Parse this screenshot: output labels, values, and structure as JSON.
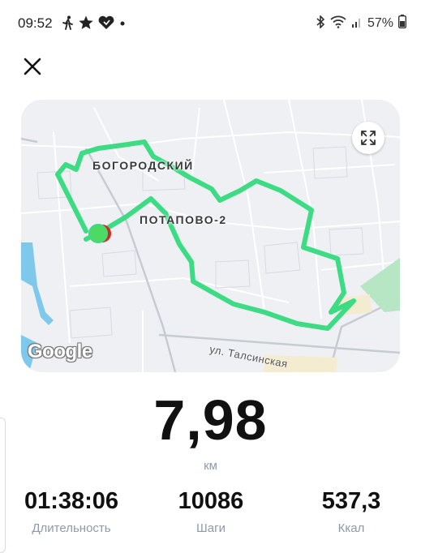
{
  "status_bar": {
    "time": "09:52",
    "left_icons": [
      "walking-icon",
      "star-icon",
      "heart-icon",
      "dot-icon"
    ],
    "right_icons": [
      "bluetooth-icon",
      "wifi-icon",
      "signal-icon",
      "battery-icon"
    ],
    "battery": "57%"
  },
  "map": {
    "labels": {
      "district_1": "БОГОРОДСКИЙ",
      "district_2": "ПОТАПОВО-2",
      "street": "ул. Талсинская"
    },
    "attribution": "Google",
    "route_color": "#3ddc84",
    "start_color": "#4cd964",
    "end_color": "#d9261c",
    "water_color": "#7ec8ec",
    "park_color": "#b6e6c4"
  },
  "workout": {
    "distance": "7,98",
    "distance_unit": "км",
    "stats": [
      {
        "value": "01:38:06",
        "label": "Длительность"
      },
      {
        "value": "10086",
        "label": "Шаги"
      },
      {
        "value": "537,3",
        "label": "Ккал"
      }
    ]
  }
}
